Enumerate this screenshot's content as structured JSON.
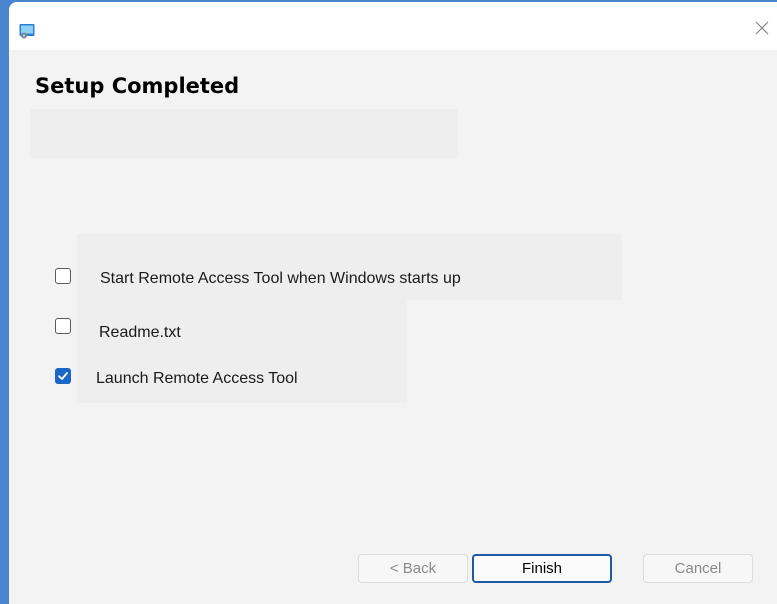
{
  "window": {
    "icon": "installer-app-icon",
    "close_icon": "close-icon"
  },
  "heading": {
    "title": "Setup Completed"
  },
  "options": [
    {
      "label": "Start Remote Access Tool when Windows starts up",
      "checked": false
    },
    {
      "label": "Readme.txt",
      "checked": false
    },
    {
      "label": "Launch Remote Access Tool",
      "checked": true
    }
  ],
  "buttons": {
    "back_label": "< Back",
    "finish_label": "Finish",
    "cancel_label": "Cancel"
  },
  "colors": {
    "desktop_background": "#4a86cf",
    "checkbox_accent": "#1a66c5",
    "default_button_border": "#1c5aa8"
  }
}
